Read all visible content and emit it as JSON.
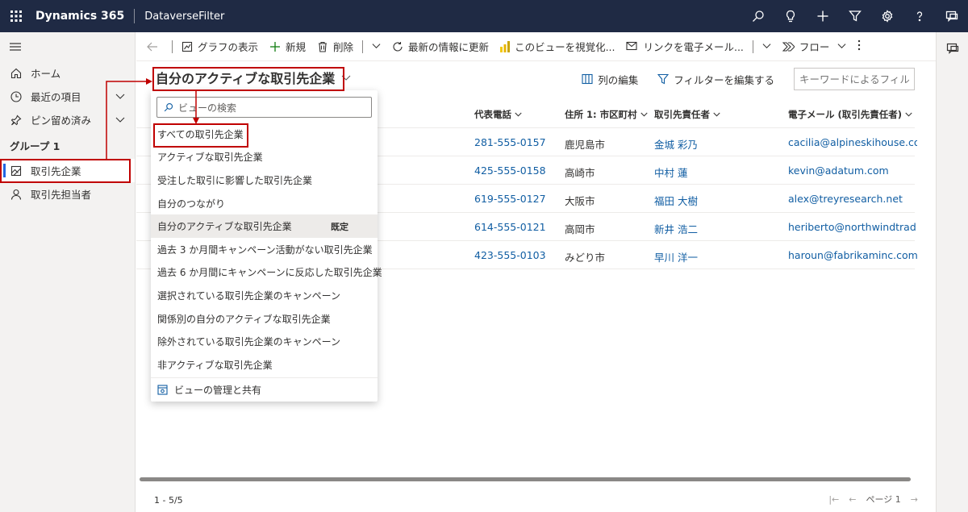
{
  "topbar": {
    "app_name": "Dynamics 365",
    "env_name": "DataverseFilter",
    "icons": [
      "search-icon",
      "lightbulb-icon",
      "plus-icon",
      "filter-icon",
      "gear-icon",
      "help-icon",
      "chat-icon"
    ]
  },
  "sidebar": {
    "items": [
      {
        "label": "ホーム",
        "icon": "home-icon"
      },
      {
        "label": "最近の項目",
        "icon": "clock-icon"
      },
      {
        "label": "ピン留め済み",
        "icon": "pin-icon"
      }
    ],
    "group_title": "グループ 1",
    "group_items": [
      {
        "label": "取引先企業",
        "icon": "account-icon",
        "selected": true
      },
      {
        "label": "取引先担当者",
        "icon": "person-icon"
      }
    ]
  },
  "commandbar": {
    "show_chart": "グラフの表示",
    "new": "新規",
    "delete": "削除",
    "refresh": "最新の情報に更新",
    "visualize": "このビューを視覚化...",
    "email_link": "リンクを電子メール...",
    "flow": "フロー"
  },
  "view": {
    "title": "自分のアクティブな取引先企業",
    "edit_columns": "列の編集",
    "edit_filters": "フィルターを編集する",
    "keyword_placeholder": "キーワードによるフィルタ-"
  },
  "grid": {
    "columns": [
      "代表電話",
      "住所 1: 市区町村",
      "取引先責任者",
      "電子メール (取引先責任者)"
    ],
    "rows": [
      {
        "phone": "281-555-0157",
        "city": "鹿児島市",
        "contact": "金城 彩乃",
        "email": "cacilia@alpineskihouse.co..."
      },
      {
        "phone": "425-555-0158",
        "city": "高崎市",
        "contact": "中村 蓮",
        "email": "kevin@adatum.com"
      },
      {
        "phone": "619-555-0127",
        "city": "大阪市",
        "contact": "福田 大樹",
        "email": "alex@treyresearch.net"
      },
      {
        "phone": "614-555-0121",
        "city": "高岡市",
        "contact": "新井 浩二",
        "email": "heriberto@northwindtrad..."
      },
      {
        "phone": "423-555-0103",
        "city": "みどり市",
        "contact": "早川 洋一",
        "email": "haroun@fabrikaminc.com"
      }
    ],
    "record_count": "1 - 5/5",
    "page_label": "ページ 1"
  },
  "dropdown": {
    "search_placeholder": "ビューの検索",
    "items": [
      {
        "label": "すべての取引先企業"
      },
      {
        "label": "アクティブな取引先企業"
      },
      {
        "label": "受注した取引に影響した取引先企業"
      },
      {
        "label": "自分のつながり"
      },
      {
        "label": "自分のアクティブな取引先企業",
        "default_label": "既定",
        "current": true
      },
      {
        "label": "過去 3 か月間キャンペーン活動がない取引先企業"
      },
      {
        "label": "過去 6 か月間にキャンペーンに反応した取引先企業"
      },
      {
        "label": "選択されている取引先企業のキャンペーン"
      },
      {
        "label": "関係別の自分のアクティブな取引先企業"
      },
      {
        "label": "除外されている取引先企業のキャンペーン"
      },
      {
        "label": "非アクティブな取引先企業"
      }
    ],
    "manage_label": "ビューの管理と共有"
  },
  "colors": {
    "topbar": "#1f2a44",
    "link": "#115ea3",
    "annotation": "#c00000",
    "selected_indicator": "#2266e3"
  }
}
